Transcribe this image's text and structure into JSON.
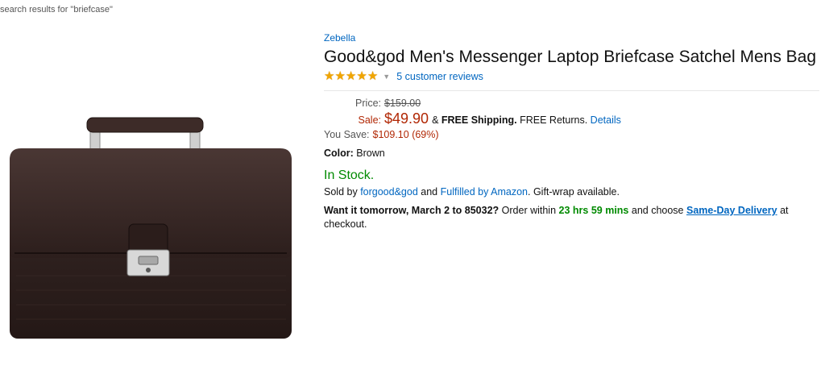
{
  "breadcrumb": "search results for \"briefcase\"",
  "product": {
    "brand": "Zebella",
    "title": "Good&god Men's Messenger Laptop Briefcase Satchel Mens Bag",
    "rating": 5,
    "reviews_text": "5 customer reviews",
    "price_label": "Price:",
    "list_price": "$159.00",
    "sale_label": "Sale:",
    "sale_price": "$49.90",
    "shipping_prefix": "&",
    "shipping_bold": "FREE Shipping.",
    "returns_text": "FREE Returns.",
    "details_link": "Details",
    "save_label": "You Save:",
    "save_value": "$109.10 (69%)",
    "color_label": "Color:",
    "color_value": "Brown",
    "stock": "In Stock.",
    "sold_by_prefix": "Sold by",
    "seller": "forgood&god",
    "and": "and",
    "fulfilled": "Fulfilled by Amazon",
    "gift": ". Gift-wrap available.",
    "want_bold": "Want it tomorrow, March 2 to 85032?",
    "order_within": "Order within",
    "time_left": "23 hrs 59 mins",
    "and_choose": "and choose",
    "same_day": "Same-Day Delivery",
    "at_checkout": "at checkout."
  },
  "colors": {
    "link": "#0066c0",
    "price_red": "#b12704",
    "stock_green": "#008a00",
    "star": "#f0a500"
  },
  "icons": [
    "star-icon",
    "chevron-down-icon"
  ]
}
